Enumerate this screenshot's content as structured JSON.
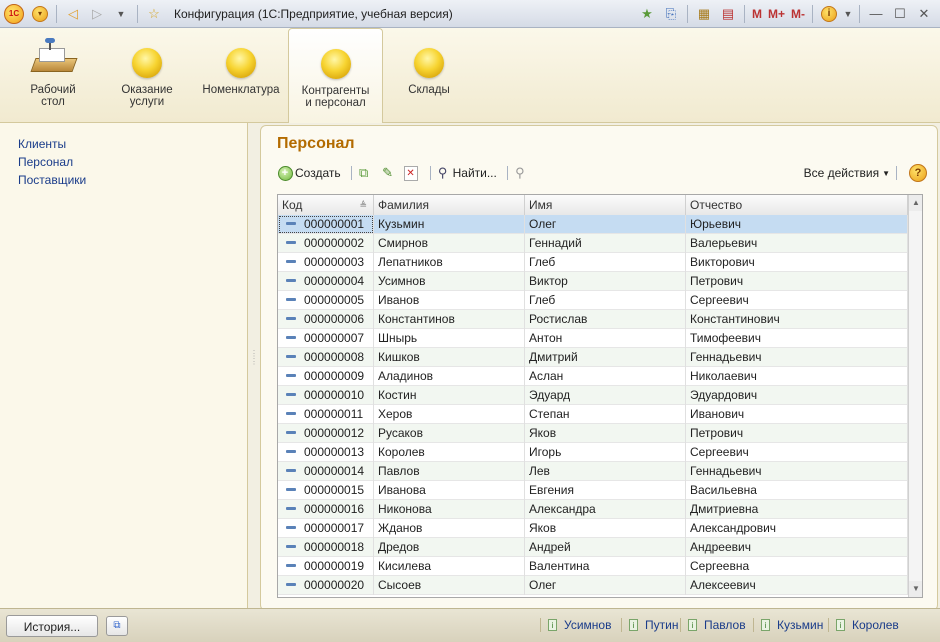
{
  "window": {
    "title": "Конфигурация  (1С:Предприятие, учебная версия)",
    "logo_text": "1С",
    "memory_buttons": [
      "M",
      "M+",
      "M-"
    ]
  },
  "sections": [
    {
      "label_line1": "Рабочий",
      "label_line2": "стол",
      "icon": "desktop-icon",
      "active": false
    },
    {
      "label_line1": "Оказание",
      "label_line2": "услуги",
      "icon": "section-ball-icon",
      "active": false
    },
    {
      "label_line1": "Номенклатура",
      "label_line2": "",
      "icon": "section-ball-icon",
      "active": false
    },
    {
      "label_line1": "Контрагенты",
      "label_line2": "и персонал",
      "icon": "section-ball-icon",
      "active": true
    },
    {
      "label_line1": "Склады",
      "label_line2": "",
      "icon": "section-ball-icon",
      "active": false
    }
  ],
  "left_nav": [
    "Клиенты",
    "Персонал",
    "Поставщики"
  ],
  "form": {
    "title": "Персонал",
    "create_label": "Создать",
    "find_label": "Найти...",
    "all_actions_label": "Все действия",
    "help_label": "?"
  },
  "table": {
    "columns": [
      "Код",
      "Фамилия",
      "Имя",
      "Отчество"
    ],
    "rows": [
      [
        "000000001",
        "Кузьмин",
        "Олег",
        "Юрьевич"
      ],
      [
        "000000002",
        "Смирнов",
        "Геннадий",
        "Валерьевич"
      ],
      [
        "000000003",
        "Лепатников",
        "Глеб",
        "Викторович"
      ],
      [
        "000000004",
        "Усимнов",
        "Виктор",
        "Петрович"
      ],
      [
        "000000005",
        "Иванов",
        "Глеб",
        "Сергеевич"
      ],
      [
        "000000006",
        "Константинов",
        "Ростислав",
        "Константинович"
      ],
      [
        "000000007",
        "Шнырь",
        "Антон",
        "Тимофеевич"
      ],
      [
        "000000008",
        "Кишков",
        "Дмитрий",
        "Геннадьевич"
      ],
      [
        "000000009",
        "Аладинов",
        "Аслан",
        "Николаевич"
      ],
      [
        "000000010",
        "Костин",
        "Эдуард",
        "Эдуардович"
      ],
      [
        "000000011",
        "Херов",
        "Степан",
        "Иванович"
      ],
      [
        "000000012",
        "Русаков",
        "Яков",
        "Петрович"
      ],
      [
        "000000013",
        "Королев",
        "Игорь",
        "Сергеевич"
      ],
      [
        "000000014",
        "Павлов",
        "Лев",
        "Геннадьевич"
      ],
      [
        "000000015",
        "Иванова",
        "Евгения",
        "Васильевна"
      ],
      [
        "000000016",
        "Никонова",
        "Александра",
        "Дмитриевна"
      ],
      [
        "000000017",
        "Жданов",
        "Яков",
        "Александрович"
      ],
      [
        "000000018",
        "Дредов",
        "Андрей",
        "Андреевич"
      ],
      [
        "000000019",
        "Кисилева",
        "Валентина",
        "Сергеевна"
      ],
      [
        "000000020",
        "Сысоев",
        "Олег",
        "Алексеевич"
      ]
    ],
    "selected_row": 0
  },
  "status": {
    "history_label": "История...",
    "recent": [
      "Усимнов",
      "Путин",
      "Павлов",
      "Кузьмин",
      "Королев"
    ]
  },
  "colors": {
    "accent_title": "#b36b00",
    "link": "#1a3c8a",
    "selection": "#c5dcf2",
    "alt_row": "#f2f7f1"
  }
}
